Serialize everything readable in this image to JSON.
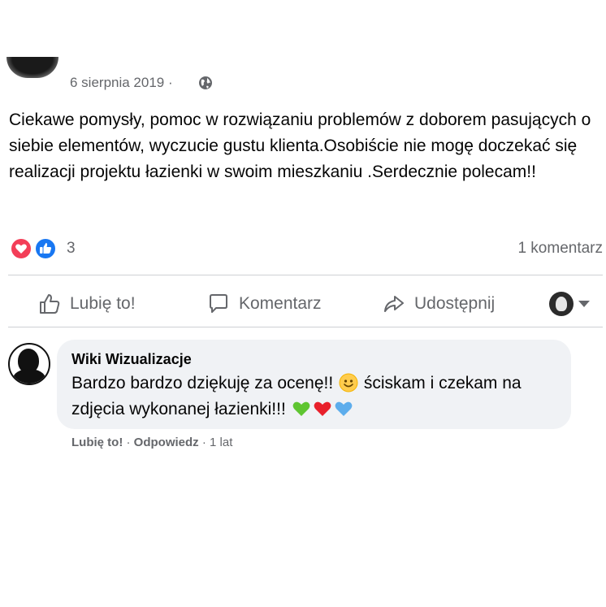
{
  "post": {
    "date": "6 sierpnia 2019",
    "date_separator": "·",
    "audience_icon": "globe-icon",
    "text": "Ciekawe pomysły, pomoc w rozwiązaniu problemów z doborem pasujących o siebie elementów, wyczucie gustu klienta.Osobiście nie mogę doczekać się realizacji projektu łazienki w swoim mieszkaniu .Serdecznie polecam!!"
  },
  "reactions": {
    "icons": [
      "love-reaction-icon",
      "like-reaction-icon"
    ],
    "count": "3",
    "comments_label": "1 komentarz",
    "colors": {
      "love": "#f33e58",
      "like": "#1877f2"
    }
  },
  "actions": {
    "like_label": "Lubię to!",
    "comment_label": "Komentarz",
    "share_label": "Udostępnij"
  },
  "comment": {
    "author": "Wiki Wizualizacje",
    "text_part1": "Bardzo bardzo dziękuję za ocenę!!",
    "text_part2": "ściskam i czekam na zdjęcia wykonanej łazienki!!!",
    "emojis_inline": [
      "smiling-face-emoji"
    ],
    "emojis_end": [
      "green-heart-emoji",
      "red-heart-emoji",
      "blue-heart-emoji"
    ],
    "footer": {
      "like": "Lubię to!",
      "sep1": "·",
      "reply": "Odpowiedz",
      "sep2": "·",
      "time": "1 lat"
    }
  },
  "colors": {
    "secondary_text": "#65676b",
    "bubble_bg": "#f0f2f5",
    "divider": "#ced0d4"
  }
}
